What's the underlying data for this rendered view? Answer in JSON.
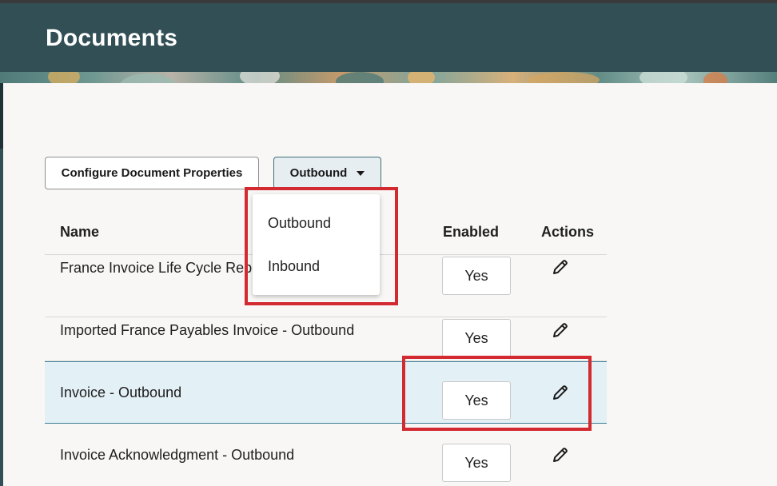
{
  "page": {
    "title": "Documents"
  },
  "toolbar": {
    "configure_label": "Configure Document Properties",
    "direction_selected": "Outbound"
  },
  "dropdown": {
    "options": [
      "Outbound",
      "Inbound"
    ]
  },
  "table": {
    "columns": {
      "name": "Name",
      "enabled": "Enabled",
      "actions": "Actions"
    },
    "rows": [
      {
        "name": "France Invoice Life Cycle Repo",
        "enabled": "Yes"
      },
      {
        "name": "Imported France Payables Invoice - Outbound",
        "enabled": "Yes"
      },
      {
        "name": "Invoice - Outbound",
        "enabled": "Yes",
        "selected": true
      },
      {
        "name": "Invoice Acknowledgment - Outbound",
        "enabled": "Yes"
      }
    ]
  },
  "colors": {
    "header": "#314f55",
    "selected_row": "#e3f0f6",
    "highlight": "#d22a30"
  },
  "icons": {
    "edit": "pencil-icon",
    "dropdown": "caret-down-icon"
  }
}
